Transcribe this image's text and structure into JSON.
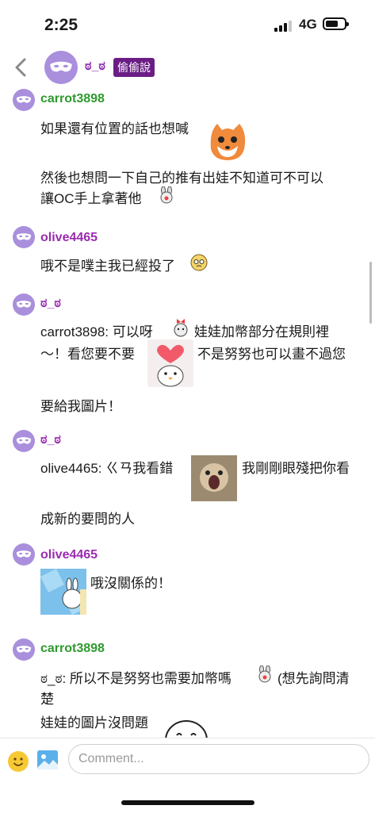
{
  "status_bar": {
    "time": "2:25",
    "network": "4G",
    "battery_level": 0.7
  },
  "header": {
    "name": "ಠ_ಠ",
    "badge": "偷偷說"
  },
  "colors": {
    "green_name": "#2e9a2e",
    "purple_name": "#9a2bb0",
    "avatar_bg": "#a98fdc",
    "badge_bg": "#6b1d86"
  },
  "messages": [
    {
      "user": "carrot3898",
      "lines": [
        "如果還有位置的話也想喊",
        "然後也想問一下自己的推有出娃不知道可不可以",
        "讓OC手上拿著他"
      ]
    },
    {
      "user": "olive4465",
      "lines": [
        "哦不是噗主我已經投了"
      ]
    },
    {
      "user": "ಠ_ಠ",
      "lines": [
        "carrot3898: 可以呀",
        "娃娃加幣部分在規則裡",
        "～！看您要不要",
        "不是努努也可以畫不過您",
        "要給我圖片！"
      ]
    },
    {
      "user": "ಠ_ಠ",
      "lines": [
        "olive4465: ㄍㄢ我看錯",
        "我剛剛眼殘把你看",
        "成新的要問的人"
      ]
    },
    {
      "user": "olive4465",
      "lines": [
        "哦沒關係的！"
      ]
    },
    {
      "user": "carrot3898",
      "lines": [
        "ಠ_ಠ: 所以不是努努也需要加幣嗎",
        "(想先詢問清",
        "楚",
        "娃娃的圖片沒問題"
      ]
    }
  ],
  "composer": {
    "placeholder": "Comment..."
  }
}
